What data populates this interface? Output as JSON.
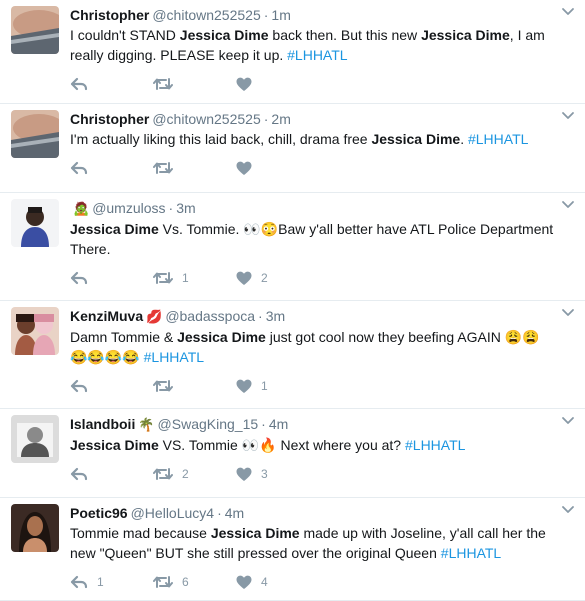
{
  "tweets": [
    {
      "name": "Christopher",
      "name_emoji": "",
      "handle": "@chitown252525",
      "time": "1m",
      "parts": [
        {
          "t": "text",
          "v": "I couldn't STAND "
        },
        {
          "t": "bold",
          "v": "Jessica Dime"
        },
        {
          "t": "text",
          "v": " back then. But this new "
        },
        {
          "t": "bold",
          "v": "Jessica Dime"
        },
        {
          "t": "text",
          "v": ", I am really digging. PLEASE keep it up. "
        },
        {
          "t": "hashtag",
          "v": "#LHHATL"
        }
      ],
      "reply_count": "",
      "retweet_count": "",
      "like_count": ""
    },
    {
      "name": "Christopher",
      "name_emoji": "",
      "handle": "@chitown252525",
      "time": "2m",
      "parts": [
        {
          "t": "text",
          "v": "I'm actually liking this laid back, chill, drama free "
        },
        {
          "t": "bold",
          "v": "Jessica Dime"
        },
        {
          "t": "text",
          "v": ". "
        },
        {
          "t": "hashtag",
          "v": "#LHHATL"
        }
      ],
      "reply_count": "",
      "retweet_count": "",
      "like_count": ""
    },
    {
      "name": "",
      "name_emoji": "🧟",
      "handle": "@umzuloss",
      "time": "3m",
      "parts": [
        {
          "t": "bold",
          "v": "Jessica Dime"
        },
        {
          "t": "text",
          "v": " Vs. Tommie. 👀😳Baw y'all better have ATL Police Department There."
        }
      ],
      "reply_count": "",
      "retweet_count": "1",
      "like_count": "2"
    },
    {
      "name": "KenziMuva",
      "name_emoji": "💋",
      "handle": "@badasspoca",
      "time": "3m",
      "parts": [
        {
          "t": "text",
          "v": "Damn Tommie & "
        },
        {
          "t": "bold",
          "v": "Jessica Dime"
        },
        {
          "t": "text",
          "v": " just got cool now they beefing AGAIN 😩😩😂😂😂😂 "
        },
        {
          "t": "hashtag",
          "v": "#LHHATL"
        }
      ],
      "reply_count": "",
      "retweet_count": "",
      "like_count": "1"
    },
    {
      "name": "Islandboii",
      "name_emoji": "🌴",
      "handle": "@SwagKing_15",
      "time": "4m",
      "parts": [
        {
          "t": "bold",
          "v": "Jessica Dime"
        },
        {
          "t": "text",
          "v": " VS. Tommie 👀🔥 Next where you at? "
        },
        {
          "t": "hashtag",
          "v": "#LHHATL"
        }
      ],
      "reply_count": "",
      "retweet_count": "2",
      "like_count": "3"
    },
    {
      "name": "Poetic96",
      "name_emoji": "",
      "handle": "@HelloLucy4",
      "time": "4m",
      "parts": [
        {
          "t": "text",
          "v": "Tommie mad because "
        },
        {
          "t": "bold",
          "v": "Jessica Dime"
        },
        {
          "t": "text",
          "v": " made up with Joseline, y'all call her the new \"Queen\" BUT she still pressed over the original Queen "
        },
        {
          "t": "hashtag",
          "v": "#LHHATL"
        }
      ],
      "reply_count": "1",
      "retweet_count": "6",
      "like_count": "4"
    }
  ],
  "icons": {
    "reply": "reply-icon",
    "retweet": "retweet-icon",
    "like": "heart-icon",
    "menu": "chevron-down-icon"
  },
  "colors": {
    "hashtag": "#1b95e0",
    "meta": "#657786",
    "action": "#8899a6",
    "divider": "#e6ecf0"
  }
}
